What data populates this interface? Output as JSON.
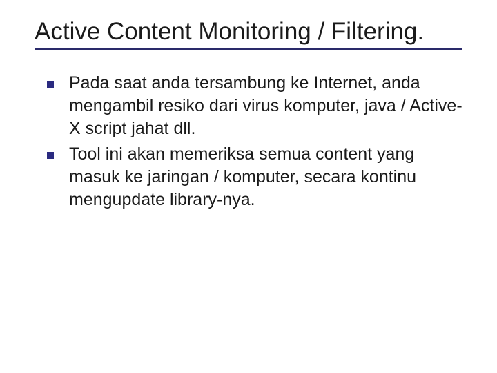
{
  "slide": {
    "title": "Active Content Monitoring / Filtering.",
    "bullets": [
      "Pada saat anda tersambung ke Internet, anda mengambil resiko dari virus komputer, java / Active-X script jahat dll.",
      "Tool ini akan memeriksa semua content yang masuk ke jaringan / komputer, secara kontinu mengupdate library-nya."
    ]
  },
  "colors": {
    "accent": "#2a2a80",
    "text": "#1a1a1a"
  }
}
